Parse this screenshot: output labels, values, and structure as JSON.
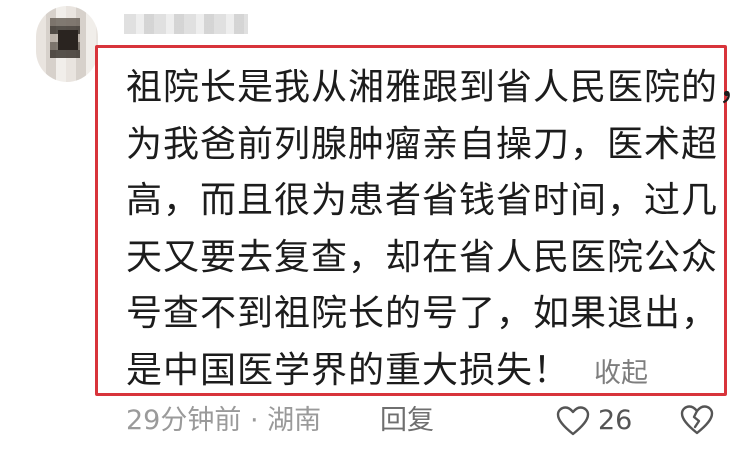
{
  "comment": {
    "lines": [
      "祖院长是我从湘雅跟到省人民医院的，",
      "为我爸前列腺肿瘤亲自操刀，医术超",
      "高，而且很为患者省钱省时间，过几",
      "天又要去复查，却在省人民医院公众",
      "号查不到祖院长的号了，如果退出，",
      "是中国医学界的重大损失！"
    ],
    "collapse_label": "收起"
  },
  "meta": {
    "time_location": "29分钟前 · 湖南",
    "reply_label": "回复",
    "like_count": "26"
  },
  "icons": {
    "like": "heart-icon",
    "dislike": "broken-heart-icon"
  },
  "colors": {
    "highlight_border": "#d8343b",
    "body_text": "#1c1c1c",
    "meta_text": "#9a9a9a"
  }
}
